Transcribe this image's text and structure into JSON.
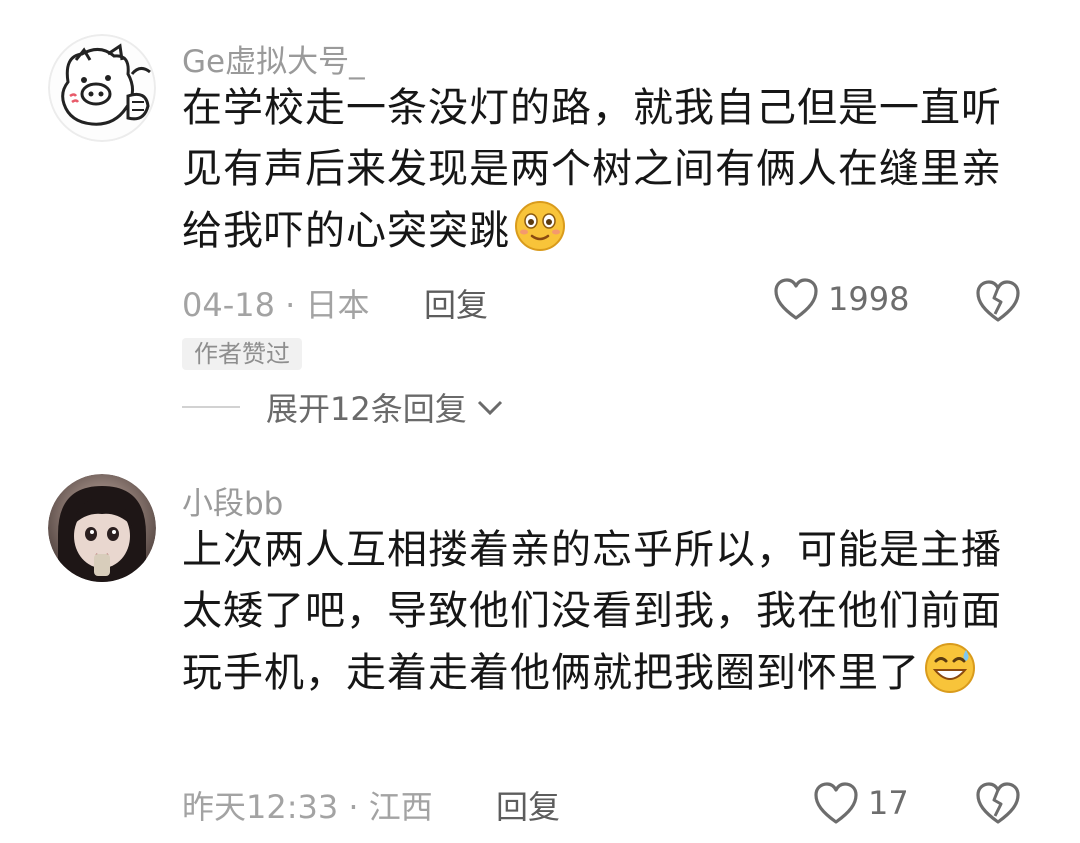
{
  "comments": [
    {
      "username": "Ge虚拟大号_",
      "text": "在学校走一条没灯的路，就我自己但是一直听见有声后来发现是两个树之间有俩人在缝里亲 给我吓的心突突跳",
      "emoji": "flushed-face-emoji",
      "meta": "04-18 · 日本",
      "reply_label": "回复",
      "likes": "1998",
      "badge": "作者赞过",
      "expand_label": "展开12条回复",
      "avatar": "pig-doodle-avatar"
    },
    {
      "username": "小段bb",
      "text": "上次两人互相搂着亲的忘乎所以，可能是主播太矮了吧，导致他们没看到我，我在他们前面玩手机，走着走着他俩就把我圈到怀里了",
      "emoji": "grinning-sweat-emoji",
      "meta": "昨天12:33 · 江西",
      "reply_label": "回复",
      "likes": "17",
      "avatar": "girl-photo-avatar"
    }
  ],
  "icons": {
    "like": "heart-outline-icon",
    "dislike": "broken-heart-icon",
    "expand": "chevron-down-icon"
  },
  "colors": {
    "username": "#9a9a9a",
    "text": "#161616",
    "meta": "#a3a3a3",
    "badge_bg": "#f1f1f1",
    "emoji_yellow": "#f8c43a"
  }
}
